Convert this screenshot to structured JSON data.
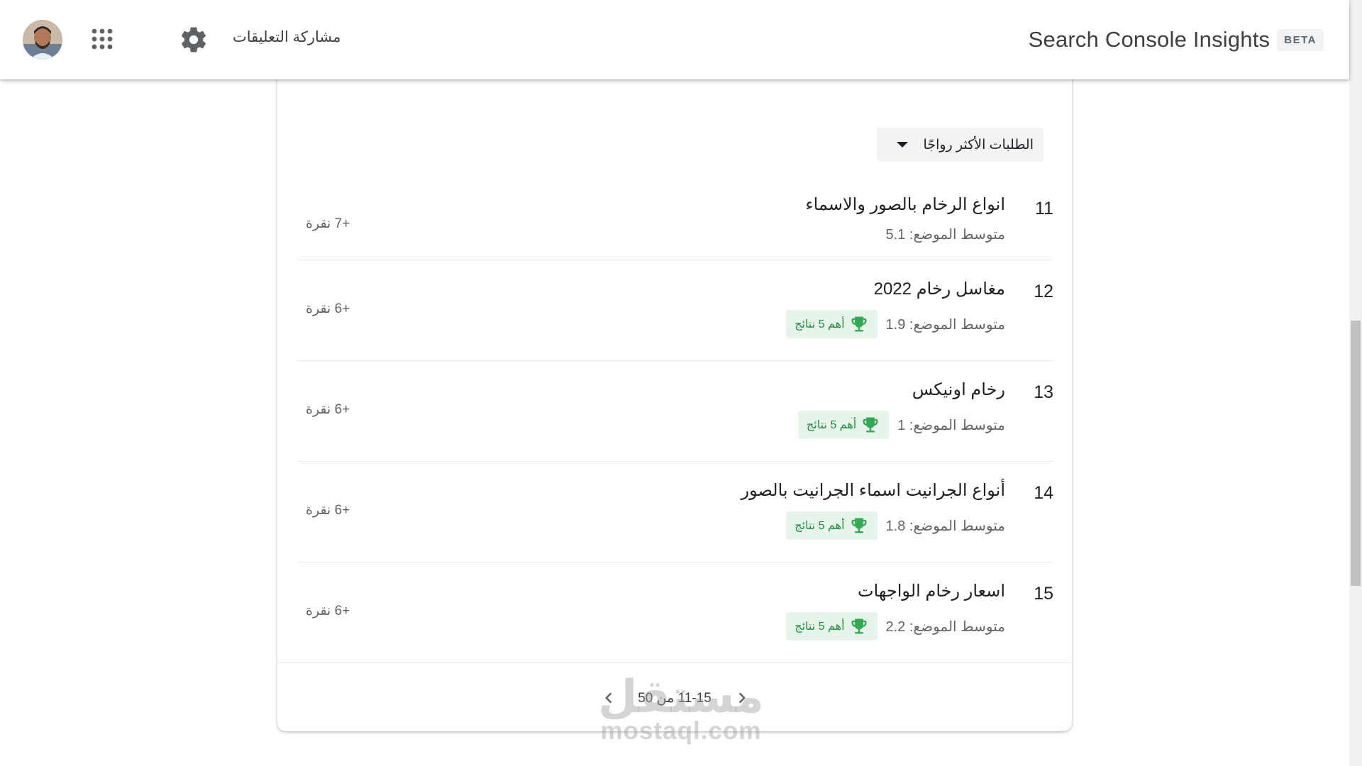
{
  "header": {
    "title": "Search Console Insights",
    "beta": "BETA",
    "feedback": "مشاركة التعليقات"
  },
  "dropdown": {
    "selected": "الطلبات الأكثر رواجًا"
  },
  "rows": [
    {
      "rank": "11",
      "query": "انواع الرخام بالصور والاسماء",
      "avg_position": "متوسط الموضع: 5.1",
      "clicks": "+7 نقرة",
      "top5": false
    },
    {
      "rank": "12",
      "query": "مغاسل رخام 2022",
      "avg_position": "متوسط الموضع: 1.9",
      "badge": "أهم 5 نتائج",
      "clicks": "+6 نقرة",
      "top5": true
    },
    {
      "rank": "13",
      "query": "رخام اونيكس",
      "avg_position": "متوسط الموضع: 1",
      "badge": "أهم 5 نتائج",
      "clicks": "+6 نقرة",
      "top5": true
    },
    {
      "rank": "14",
      "query": "أنواع الجرانيت اسماء الجرانيت بالصور",
      "avg_position": "متوسط الموضع: 1.8",
      "badge": "أهم 5 نتائج",
      "clicks": "+6 نقرة",
      "top5": true
    },
    {
      "rank": "15",
      "query": "اسعار رخام الواجهات",
      "avg_position": "متوسط الموضع: 2.2",
      "badge": "أهم 5 نتائج",
      "clicks": "+6 نقرة",
      "top5": true
    }
  ],
  "pagination": {
    "label": "11-15 من 50"
  },
  "colors": {
    "badge_bg": "#e6f4ea",
    "badge_text": "#1e8e3e",
    "trophy": "#34a853"
  },
  "watermark": {
    "logo": "مستقل",
    "text": "mostaql.com"
  }
}
